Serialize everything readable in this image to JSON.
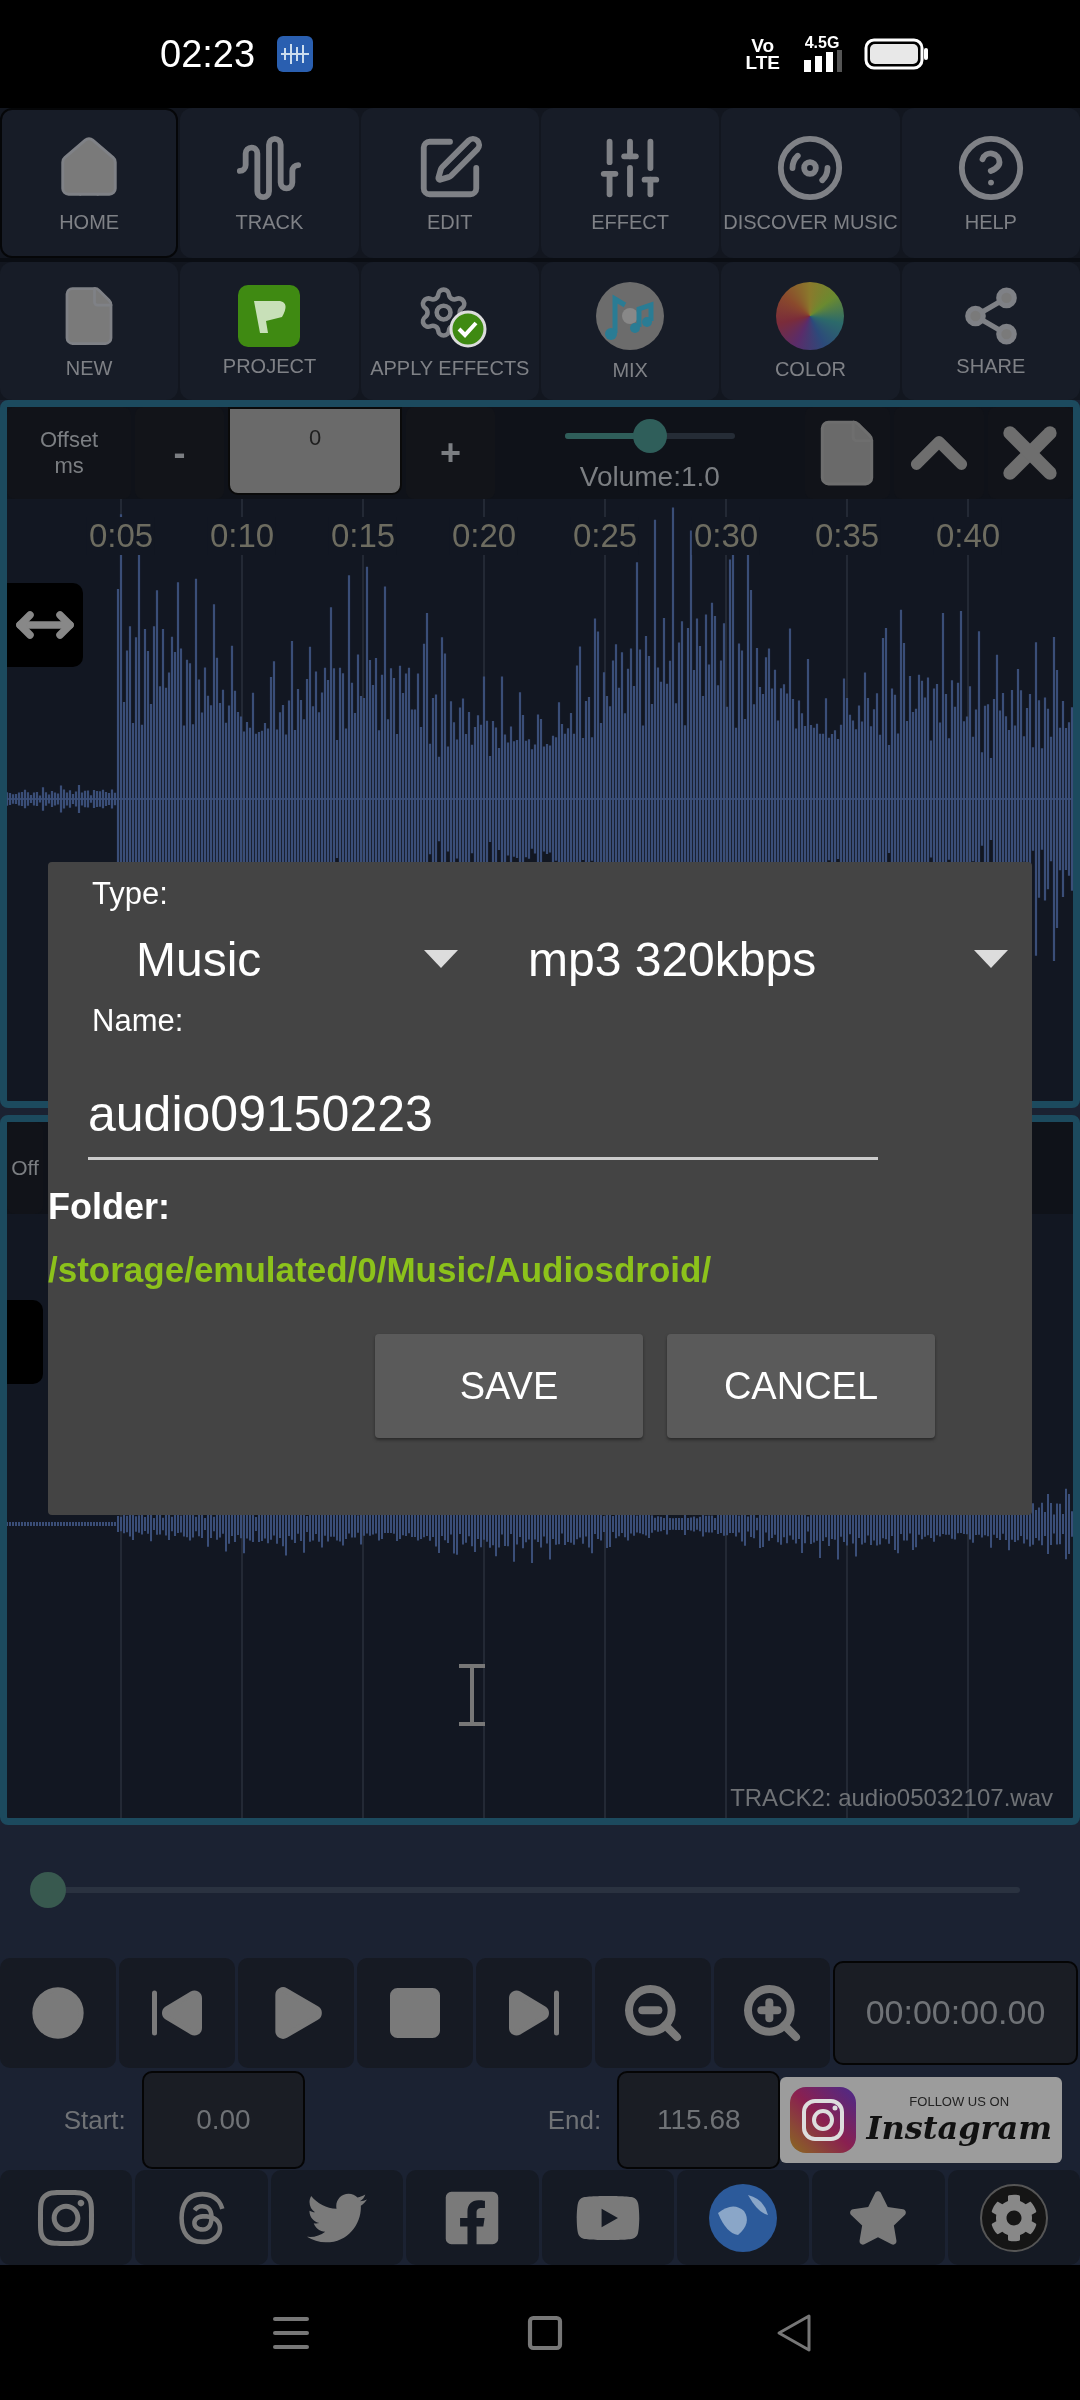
{
  "status_bar": {
    "time": "02:23",
    "network": [
      "Vo",
      "LTE",
      "4.5G"
    ]
  },
  "toolbar_rows": [
    [
      {
        "label": "HOME",
        "kind": "home",
        "selected": true
      },
      {
        "label": "TRACK",
        "kind": "track",
        "selected": false
      },
      {
        "label": "EDIT",
        "kind": "edit",
        "selected": false
      },
      {
        "label": "EFFECT",
        "kind": "effect",
        "selected": false
      },
      {
        "label": "DISCOVER MUSIC",
        "kind": "discover",
        "selected": false
      },
      {
        "label": "HELP",
        "kind": "help",
        "selected": false
      }
    ],
    [
      {
        "label": "NEW",
        "kind": "new",
        "selected": false
      },
      {
        "label": "PROJECT",
        "kind": "project",
        "selected": false
      },
      {
        "label": "APPLY EFFECTS",
        "kind": "apply",
        "selected": false
      },
      {
        "label": "MIX",
        "kind": "mix",
        "selected": false
      },
      {
        "label": "COLOR",
        "kind": "color",
        "selected": false
      },
      {
        "label": "SHARE",
        "kind": "share",
        "selected": false
      }
    ]
  ],
  "track1": {
    "offset_label": "Offset ms",
    "minus": "-",
    "offset_value": "0",
    "plus": "+",
    "volume": {
      "level": 0.5
    },
    "volume_label": "Volume:1.0",
    "timeline": [
      "0:05",
      "0:10",
      "0:15",
      "0:20",
      "0:25",
      "0:30",
      "0:35",
      "0:40"
    ]
  },
  "track2": {
    "offset_label": "Off",
    "name": "TRACK2: audio05032107.wav"
  },
  "dialog": {
    "type_label": "Type:",
    "dropdowns": [
      "Music",
      "mp3 320kbps"
    ],
    "name_label": "Name:",
    "name_value": "audio09150223",
    "folder_label": "Folder:",
    "folder_path": "/storage/emulated/0/Music/Audiosdroid/",
    "buttons": [
      "SAVE",
      "CANCEL"
    ]
  },
  "position": {
    "level": 0
  },
  "transport": {
    "time": "00:00:00.00"
  },
  "range": {
    "start_label": "Start:",
    "start": "0.00",
    "end_label": "End:",
    "end": "115.68"
  },
  "promo": {
    "top": "FOLLOW US ON",
    "brand": "Instagram"
  }
}
